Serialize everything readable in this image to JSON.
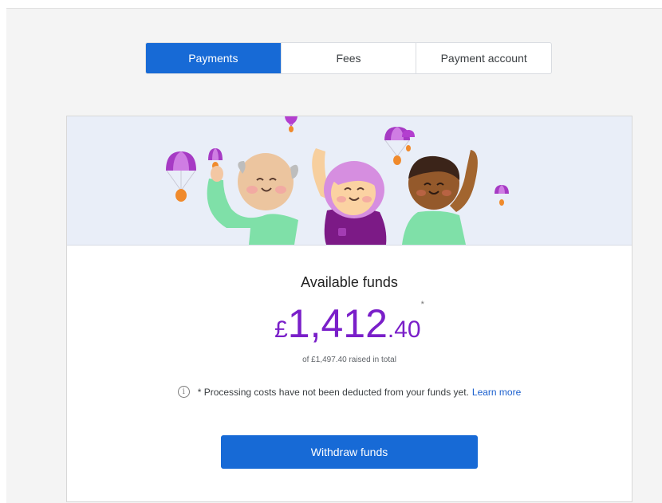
{
  "tabs": [
    {
      "label": "Payments",
      "active": true
    },
    {
      "label": "Fees",
      "active": false
    },
    {
      "label": "Payment account",
      "active": false
    }
  ],
  "funds": {
    "title": "Available funds",
    "currency": "£",
    "amount_whole": "1,412",
    "amount_pence": ".40",
    "asterisk": "*",
    "raised_total": "of £1,497.40 raised in total"
  },
  "notice": {
    "icon": "info-icon",
    "text": "* Processing costs have not been deducted from your funds yet.",
    "link_label": "Learn more"
  },
  "withdraw_button": {
    "label": "Withdraw funds"
  },
  "colors": {
    "primary": "#176ad6",
    "amount": "#7a1fc9",
    "banner_bg": "#e9eef8",
    "page_bg": "#f4f4f4"
  }
}
